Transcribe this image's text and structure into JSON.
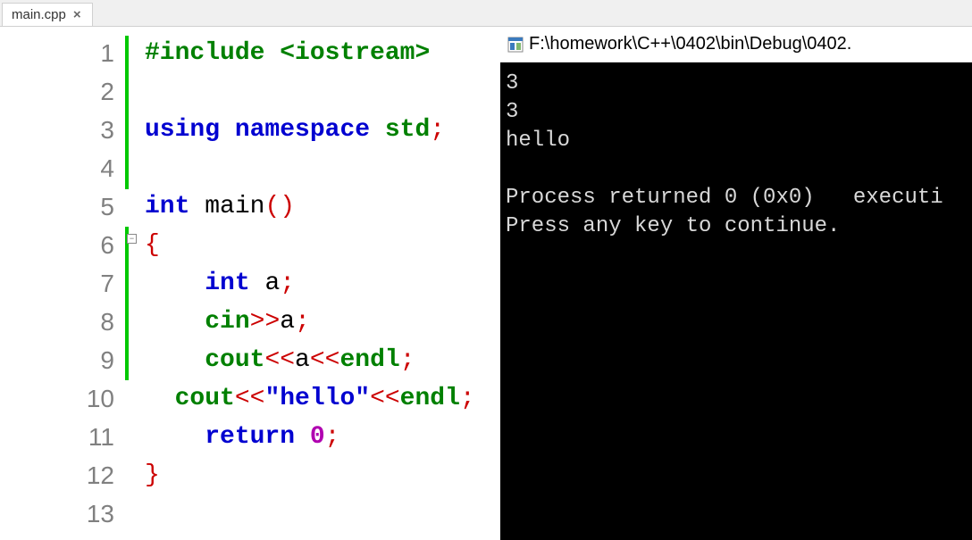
{
  "tab": {
    "filename": "main.cpp",
    "close_glyph": "×"
  },
  "editor": {
    "line_numbers": [
      "1",
      "2",
      "3",
      "4",
      "5",
      "6",
      "7",
      "8",
      "9",
      "10",
      "11",
      "12",
      "13"
    ],
    "fold_glyph": "−",
    "code": {
      "l1_include": "#include <iostream>",
      "l3_using": "using",
      "l3_namespace": "namespace",
      "l3_std": "std",
      "l3_semi": ";",
      "l5_int": "int",
      "l5_main": " main",
      "l5_paren": "()",
      "l6_brace": "{",
      "l7_int": "int",
      "l7_a": " a",
      "l7_semi": ";",
      "l8_cin": "cin",
      "l8_op": ">>",
      "l8_a": "a",
      "l8_semi": ";",
      "l9_cout": "cout",
      "l9_op1": "<<",
      "l9_a": "a",
      "l9_op2": "<<",
      "l9_endl": "endl",
      "l9_semi": ";",
      "l10_cout": "cout",
      "l10_op1": "<<",
      "l10_str": "\"hello\"",
      "l10_op2": "<<",
      "l10_endl": "endl",
      "l10_semi": ";",
      "l11_return": "return",
      "l11_zero": " 0",
      "l11_semi": ";",
      "l12_brace": "}"
    }
  },
  "console": {
    "title": "F:\\homework\\C++\\0402\\bin\\Debug\\0402.",
    "output": "3\n3\nhello\n\nProcess returned 0 (0x0)   executi\nPress any key to continue."
  }
}
